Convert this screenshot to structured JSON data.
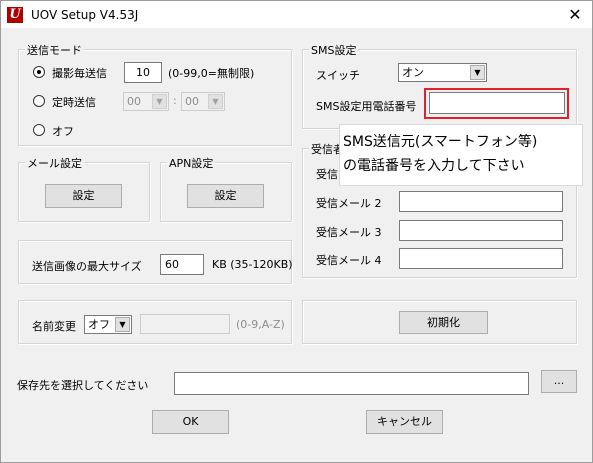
{
  "window": {
    "title": "UOV Setup V4.53J",
    "app_icon_letter": "U",
    "close_glyph": "✕"
  },
  "send_mode": {
    "title": "送信モード",
    "per_shot_label": "撮影毎送信",
    "per_shot_value": "10",
    "per_shot_hint": "(0-99,0=無制限)",
    "timed_label": "定時送信",
    "timed_hour": "00",
    "timed_sep": ":",
    "timed_minute": "00",
    "off_label": "オフ",
    "selected": "per_shot"
  },
  "mail_settings": {
    "title": "メール設定",
    "button": "設定"
  },
  "apn_settings": {
    "title": "APN設定",
    "button": "設定"
  },
  "image_size": {
    "label": "送信画像の最大サイズ",
    "value": "60",
    "unit": "KB (35-120KB)"
  },
  "rename": {
    "label": "名前変更",
    "value": "オフ",
    "input_value": "",
    "hint": "(0-9,A-Z)"
  },
  "sms": {
    "title": "SMS設定",
    "switch_label": "スイッチ",
    "switch_value": "オン",
    "phone_label": "SMS設定用電話番号",
    "phone_value": ""
  },
  "recipients": {
    "title": "受信者",
    "items": [
      {
        "label": "受信",
        "value": ""
      },
      {
        "label": "受信メール 2",
        "value": ""
      },
      {
        "label": "受信メール 3",
        "value": ""
      },
      {
        "label": "受信メール 4",
        "value": ""
      }
    ]
  },
  "tooltip": {
    "line1": "SMS送信元(スマートフォン等)",
    "line2": "の電話番号を入力して下さい"
  },
  "initialize_button": "初期化",
  "save_location": {
    "label": "保存先を選択してください",
    "value": "",
    "browse": "..."
  },
  "ok_button": "OK",
  "cancel_button": "キャンセル",
  "colors": {
    "highlight": "#e0202a",
    "app_icon": "#b00000"
  }
}
